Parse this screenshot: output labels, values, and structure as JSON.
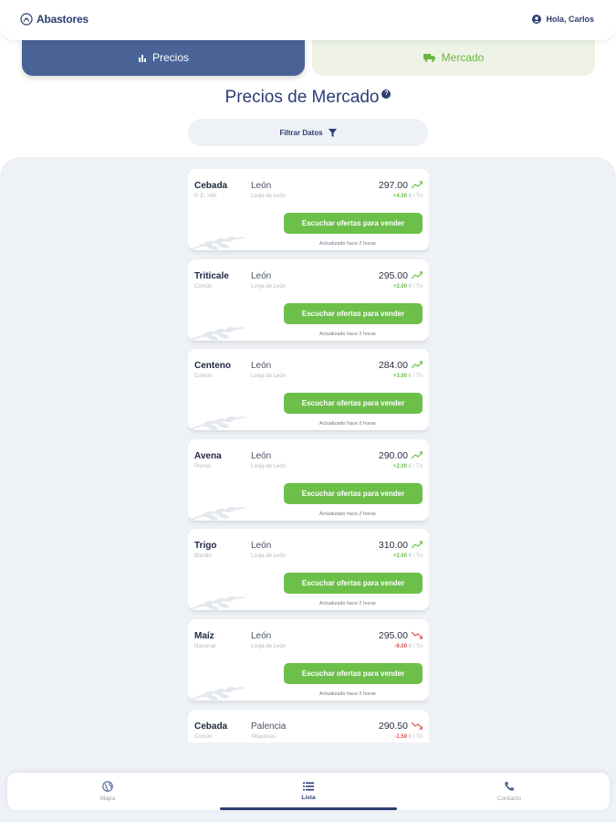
{
  "header": {
    "logo_text": "Abastores",
    "user_greeting": "Hola, Carlos"
  },
  "tabs": [
    {
      "label": "Precios",
      "icon": "bar-chart-icon",
      "active": true
    },
    {
      "label": "Mercado",
      "icon": "truck-icon",
      "active": false
    }
  ],
  "page": {
    "title": "Precios de Mercado",
    "help_icon": "?"
  },
  "filter": {
    "label": "Filtrar Datos",
    "icon": "filter-icon"
  },
  "colors": {
    "primary": "#2c3e73",
    "accent_green": "#6cc04a",
    "trend_up": "#6cc04a",
    "trend_down": "#e0514b"
  },
  "cards": [
    {
      "name": "Cebada",
      "variety": "P. E. >60",
      "city": "León",
      "source": "Lonja de León",
      "price": "297.00",
      "change": "+4.00",
      "unit": "€ / Tn",
      "trend": "up",
      "button": "Escuchar ofertas para vender",
      "updated": "Actualizado hace 2 horas"
    },
    {
      "name": "Triticale",
      "variety": "Común",
      "city": "León",
      "source": "Lonja de León",
      "price": "295.00",
      "change": "+2.00",
      "unit": "€ / Tn",
      "trend": "up",
      "button": "Escuchar ofertas para vender",
      "updated": "Actualizado hace 2 horas"
    },
    {
      "name": "Centeno",
      "variety": "Común",
      "city": "León",
      "source": "Lonja de León",
      "price": "284.00",
      "change": "+3.00",
      "unit": "€ / Tn",
      "trend": "up",
      "button": "Escuchar ofertas para vender",
      "updated": "Actualizado hace 2 horas"
    },
    {
      "name": "Avena",
      "variety": "Pienso",
      "city": "León",
      "source": "Lonja de León",
      "price": "290.00",
      "change": "+2.00",
      "unit": "€ / Tn",
      "trend": "up",
      "button": "Escuchar ofertas para vender",
      "updated": "Actualizado hace 2 horas"
    },
    {
      "name": "Trigo",
      "variety": "Blando",
      "city": "León",
      "source": "Lonja de León",
      "price": "310.00",
      "change": "+2.00",
      "unit": "€ / Tn",
      "trend": "up",
      "button": "Escuchar ofertas para vender",
      "updated": "Actualizado hace 2 horas"
    },
    {
      "name": "Maíz",
      "variety": "Nacional",
      "city": "León",
      "source": "Lonja de León",
      "price": "295.00",
      "change": "-9.00",
      "unit": "€ / Tn",
      "trend": "down",
      "button": "Escuchar ofertas para vender",
      "updated": "Actualizado hace 2 horas"
    },
    {
      "name": "Cebada",
      "variety": "Común",
      "city": "Palencia",
      "source": "Abastores",
      "price": "290.50",
      "change": "-1.50",
      "unit": "€ / Tn",
      "trend": "down",
      "button": "",
      "updated": ""
    }
  ],
  "bottom_nav": [
    {
      "label": "Mapa",
      "icon": "globe-icon",
      "active": false
    },
    {
      "label": "Lista",
      "icon": "list-icon",
      "active": true
    },
    {
      "label": "Contacto",
      "icon": "phone-icon",
      "active": false
    }
  ]
}
